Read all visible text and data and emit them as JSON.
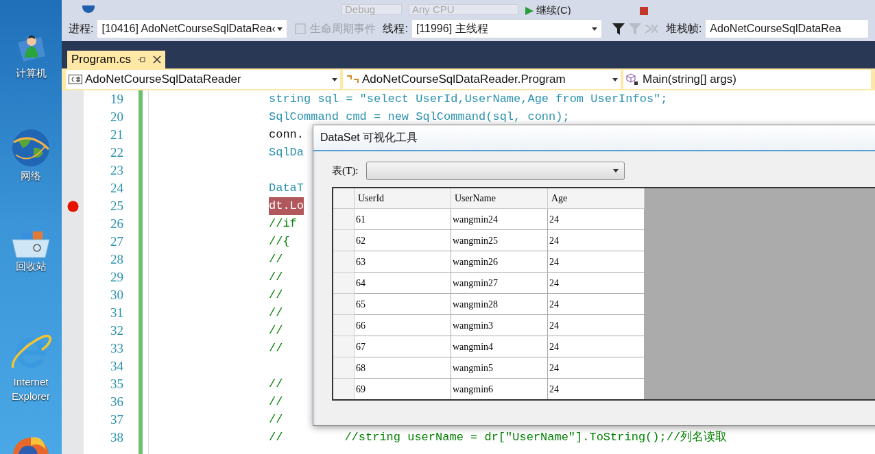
{
  "desktop": {
    "icons": [
      {
        "kind": "computer",
        "label": "计算机"
      },
      {
        "kind": "network",
        "label": "网络"
      },
      {
        "kind": "recycle",
        "label": "回收站"
      },
      {
        "kind": "ie",
        "label": "Internet Explorer"
      },
      {
        "kind": "firefox"
      }
    ]
  },
  "toolbar_top": {
    "config": "Debug",
    "platform": "Any CPU",
    "continue": "继续(C)"
  },
  "debug_location": {
    "process_label": "进程:",
    "process": "[10416] AdoNetCourseSqlDataRea‹",
    "lifecycle": "生命周期事件",
    "thread_label": "线程:",
    "thread": "[11996] 主线程",
    "stack_label": "堆栈帧:",
    "stack": "AdoNetCourseSqlDataRea"
  },
  "tabs": [
    {
      "label": "Program.cs",
      "selected": true
    }
  ],
  "nav_bar": {
    "project": "AdoNetCourseSqlDataReader",
    "class": "AdoNetCourseSqlDataReader.Program",
    "member": "Main(string[] args)"
  },
  "editor": {
    "lines": [
      {
        "number": "19",
        "kind": "code",
        "text": "string sql = \"select UserId,UserName,Age from UserInfos\";"
      },
      {
        "number": "20",
        "kind": "code",
        "text": "SqlCommand cmd = new SqlCommand(sql, conn);"
      },
      {
        "number": "21",
        "kind": "plain",
        "text": "conn."
      },
      {
        "number": "22",
        "kind": "code",
        "text": "SqlDa"
      },
      {
        "number": "23",
        "kind": "plain"
      },
      {
        "number": "24",
        "kind": "code",
        "text": "DataT"
      },
      {
        "number": "25",
        "kind": "breakpoint",
        "text": "dt.Lo"
      },
      {
        "number": "26",
        "kind": "comment",
        "text": "//if"
      },
      {
        "number": "27",
        "kind": "comment",
        "text": "//{"
      },
      {
        "number": "28",
        "kind": "comment",
        "text": "//"
      },
      {
        "number": "29",
        "kind": "comment",
        "text": "//"
      },
      {
        "number": "30",
        "kind": "comment",
        "text": "//"
      },
      {
        "number": "31",
        "kind": "comment",
        "text": "//"
      },
      {
        "number": "32",
        "kind": "comment",
        "text": "//"
      },
      {
        "number": "33",
        "kind": "comment",
        "text": "//"
      },
      {
        "number": "34",
        "kind": "plain"
      },
      {
        "number": "35",
        "kind": "comment",
        "text": "//"
      },
      {
        "number": "36",
        "kind": "comment",
        "text": "//"
      },
      {
        "number": "37",
        "kind": "comment",
        "text": "//"
      },
      {
        "number": "38",
        "kind": "comment",
        "text": "//",
        "tail": "//string userName = dr[\"UserName\"].ToString();//列名读取"
      }
    ]
  },
  "dialog": {
    "title": "DataSet 可视化工具",
    "table_label": "表(T):",
    "grid": {
      "columns": [
        "UserId",
        "UserName",
        "Age"
      ],
      "rows": [
        [
          "61",
          "wangmin24",
          "24"
        ],
        [
          "62",
          "wangmin25",
          "24"
        ],
        [
          "63",
          "wangmin26",
          "24"
        ],
        [
          "64",
          "wangmin27",
          "24"
        ],
        [
          "65",
          "wangmin28",
          "24"
        ],
        [
          "66",
          "wangmin3",
          "24"
        ],
        [
          "67",
          "wangmin4",
          "24"
        ],
        [
          "68",
          "wangmin5",
          "24"
        ],
        [
          "69",
          "wangmin6",
          "24"
        ]
      ]
    }
  }
}
